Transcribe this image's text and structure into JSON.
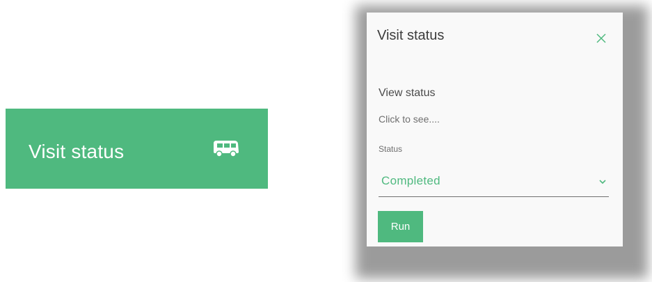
{
  "tile": {
    "label": "Visit status",
    "icon": "van-icon",
    "background": "#4fb97f"
  },
  "panel": {
    "title": "Visit status",
    "close_icon": "close-icon",
    "section_title": "View status",
    "description": "Click to see....",
    "status_label": "Status",
    "status_value": "Completed",
    "dropdown_icon": "chevron-down-icon",
    "run_label": "Run",
    "accent": "#4fb97f"
  }
}
